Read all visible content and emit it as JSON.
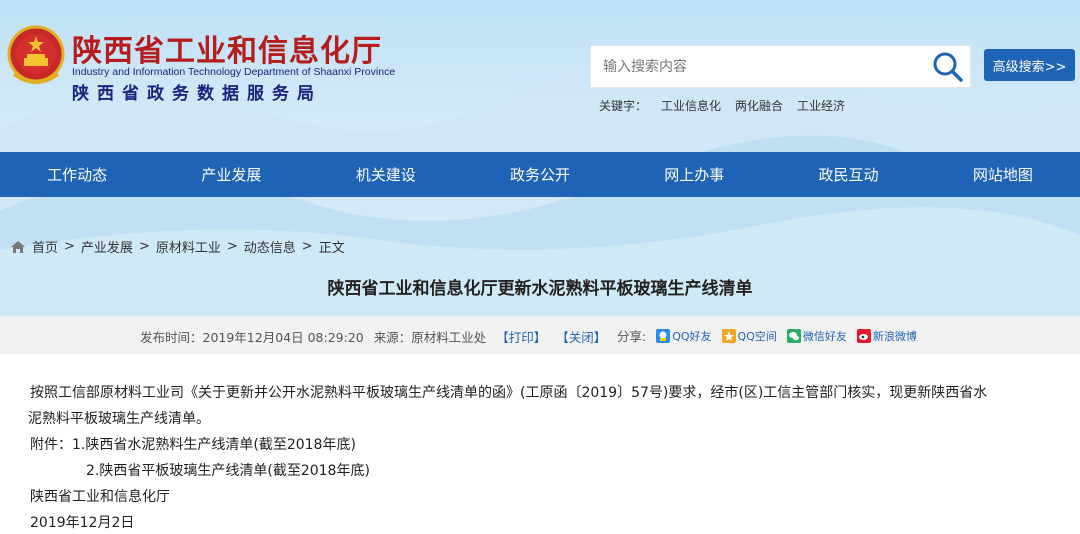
{
  "header": {
    "title_cn": "陕西省工业和信息化厅",
    "title_en": "Industry and Information Technology Department of Shaanxi Province",
    "subtitle": "陕西省政务数据服务局"
  },
  "search": {
    "placeholder": "输入搜索内容",
    "advanced_label": "高级搜索>>"
  },
  "keywords": {
    "label": "关键字：",
    "items": [
      "工业信息化",
      "两化融合",
      "工业经济"
    ]
  },
  "nav": {
    "items": [
      "工作动态",
      "产业发展",
      "机关建设",
      "政务公开",
      "网上办事",
      "政民互动",
      "网站地图"
    ]
  },
  "breadcrumb": {
    "items": [
      "首页",
      "产业发展",
      "原材料工业",
      "动态信息",
      "正文"
    ],
    "separator": ">"
  },
  "article": {
    "title": "陕西省工业和信息化厅更新水泥熟料平板玻璃生产线清单",
    "meta": {
      "publish_label": "发布时间：2019年12月04日 08:29:20",
      "source_label": "来源：原材料工业处",
      "print_label": "【打印】",
      "close_label": "【关闭】",
      "share_label": "分享:",
      "share_items": [
        "QQ好友",
        "QQ空间",
        "微信好友",
        "新浪微博"
      ]
    },
    "body": {
      "line1": "按照工信部原材料工业司《关于更新并公开水泥熟料平板玻璃生产线清单的函》(工原函〔2019〕57号)要求，经市(区)工信主管部门核实，现更新陕西省水",
      "line2": "泥熟料平板玻璃生产线清单。",
      "attach1": "附件：1.陕西省水泥熟料生产线清单(截至2018年底)",
      "attach2": "2.陕西省平板玻璃生产线清单(截至2018年底)",
      "signature": "陕西省工业和信息化厅",
      "date": "2019年12月2日"
    }
  },
  "colors": {
    "brand_blue": "#1e63b5",
    "title_red": "#b71c1c",
    "meta_bar": "#f2f2f2"
  }
}
